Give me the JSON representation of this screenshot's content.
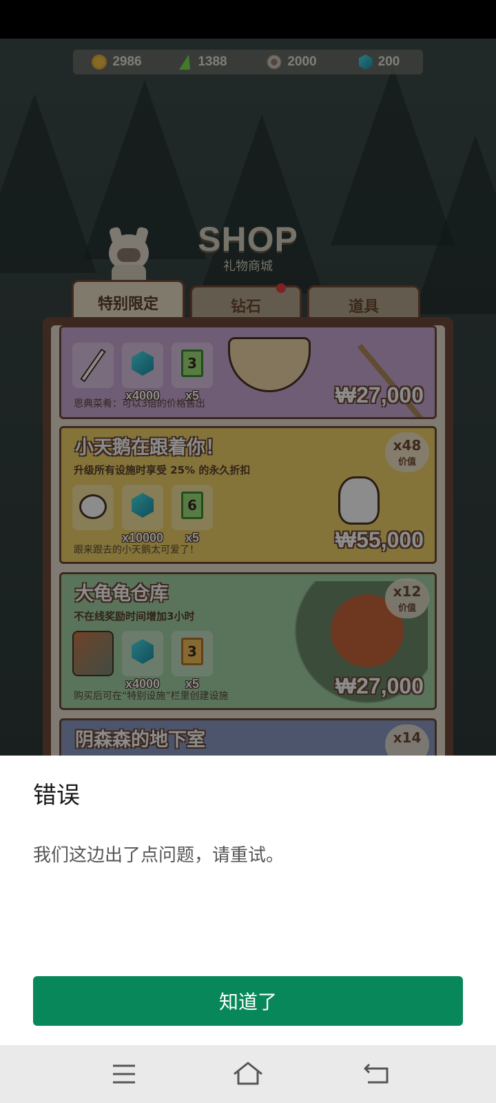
{
  "currencies": [
    {
      "icon": "coin-icon",
      "value": "2986"
    },
    {
      "icon": "energy-icon",
      "value": "1388"
    },
    {
      "icon": "gear-icon",
      "value": "2000"
    },
    {
      "icon": "gem-icon",
      "value": "200"
    }
  ],
  "shop": {
    "title": "SHOP",
    "subtitle": "礼物商城"
  },
  "tabs": [
    {
      "label": "特别限定",
      "active": true
    },
    {
      "label": "钻石",
      "active": false,
      "notification": true
    },
    {
      "label": "道具",
      "active": false
    }
  ],
  "cards": [
    {
      "title": "",
      "description": "",
      "items": [
        {
          "icon": "magic-wand-icon",
          "qty": ""
        },
        {
          "icon": "gem-icon",
          "qty": "x4000"
        },
        {
          "icon": "ticket-icon",
          "ticket_value": "3",
          "qty": "x5"
        }
      ],
      "note": "恩典菜肴：可以3倍的价格售出",
      "price": "₩27,000",
      "bg_color": "#c9a9d6"
    },
    {
      "title": "小天鹅在跟着你！",
      "description": "升级所有设施时享受 25% 的永久折扣",
      "items": [
        {
          "icon": "duck-icon",
          "qty": ""
        },
        {
          "icon": "gem-icon",
          "qty": "x10000"
        },
        {
          "icon": "ticket-icon",
          "ticket_value": "6",
          "qty": "x5"
        }
      ],
      "note": "跟来跟去的小天鹅太可爱了！",
      "price": "₩55,000",
      "badge": {
        "multiplier": "x48",
        "label": "价值"
      },
      "bg_color": "#f1d46a"
    },
    {
      "title": "大龟龟仓库",
      "description": "不在线奖励时间增加3小时",
      "items": [
        {
          "icon": "turtle-thumbnail-icon",
          "qty": ""
        },
        {
          "icon": "gem-icon",
          "qty": "x4000"
        },
        {
          "icon": "ticket-icon",
          "ticket_value": "3",
          "qty": "x5"
        }
      ],
      "note": "购买后可在“特别设施”栏里创建设施",
      "price": "₩27,000",
      "badge": {
        "multiplier": "x12",
        "label": "价值"
      },
      "bg_color": "#a5d3a8"
    },
    {
      "title": "阴森森的地下室",
      "badge": {
        "multiplier": "x14",
        "label": ""
      },
      "bg_color": "#8a9bc4"
    }
  ],
  "dialog": {
    "title": "错误",
    "message": "我们这边出了点问题，请重试。",
    "button_label": "知道了",
    "accent_color": "#07875a"
  },
  "nav": {
    "items": [
      "menu-icon",
      "home-icon",
      "back-icon"
    ]
  }
}
